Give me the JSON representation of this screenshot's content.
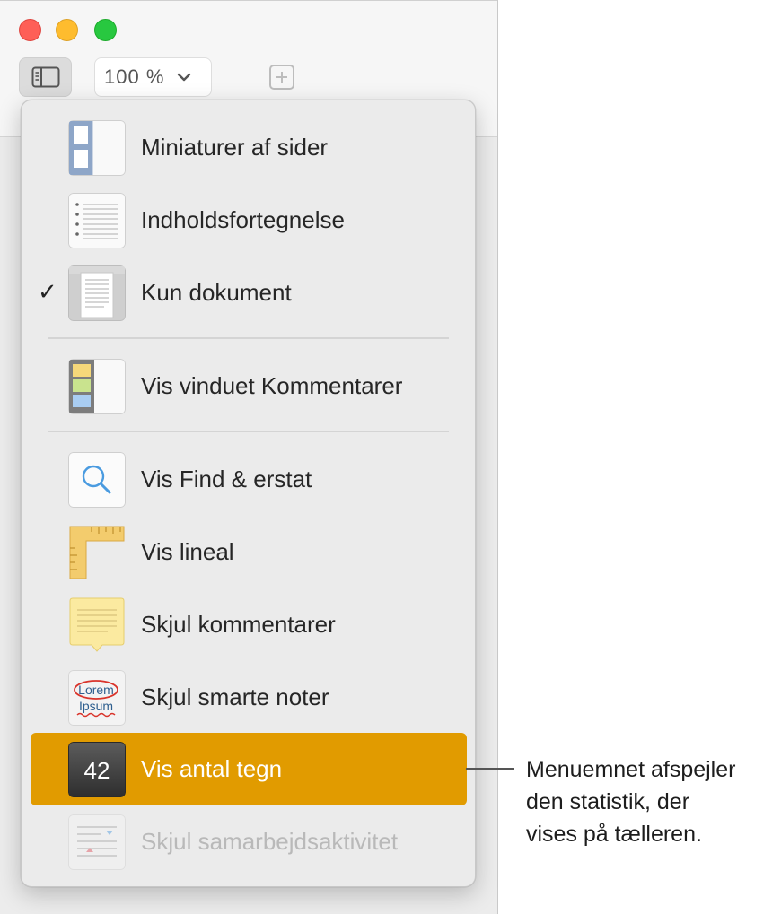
{
  "toolbar": {
    "zoom_label": "100 %"
  },
  "menu": {
    "items": [
      {
        "label": "Miniaturer af sider",
        "icon": "page-thumbnails-icon",
        "checked": false
      },
      {
        "label": "Indholdsfortegnelse",
        "icon": "table-of-contents-icon",
        "checked": false
      },
      {
        "label": "Kun dokument",
        "icon": "document-only-icon",
        "checked": true,
        "check_glyph": "✓"
      },
      {
        "label": "Vis vinduet Kommentarer",
        "icon": "comments-pane-icon",
        "checked": false
      },
      {
        "label": "Vis Find & erstat",
        "icon": "find-replace-icon",
        "checked": false
      },
      {
        "label": "Vis lineal",
        "icon": "ruler-icon",
        "checked": false
      },
      {
        "label": "Skjul kommentarer",
        "icon": "comment-note-icon",
        "checked": false
      },
      {
        "label": "Skjul smarte noter",
        "icon": "smart-annotation-icon",
        "checked": false,
        "icon_text_top": "Lorem",
        "icon_text_bottom": "Ipsum"
      },
      {
        "label": "Vis antal tegn",
        "icon": "word-count-icon",
        "checked": false,
        "highlighted": true,
        "icon_text": "42"
      },
      {
        "label": "Skjul samarbejdsaktivitet",
        "icon": "collaboration-activity-icon",
        "checked": false,
        "disabled": true
      }
    ]
  },
  "callout": {
    "lines": [
      "Menuemnet afspejler",
      "den statistik, der",
      "vises på tælleren."
    ]
  },
  "colors": {
    "highlight": "#e19b00",
    "traffic_red": "#fe5f57",
    "traffic_yellow": "#febc2e",
    "traffic_green": "#28c840"
  }
}
